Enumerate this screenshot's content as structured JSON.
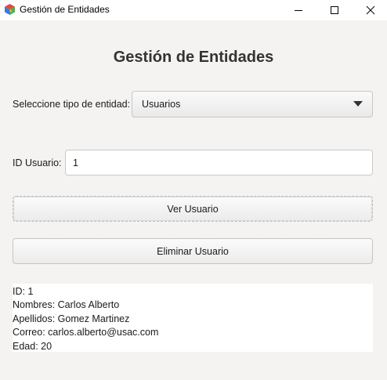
{
  "window": {
    "title": "Gestión de Entidades",
    "minimize_glyph": "—",
    "maximize_glyph": "☐",
    "close_glyph": "✕"
  },
  "main": {
    "heading": "Gestión de Entidades",
    "entity_type_label": "Seleccione tipo de entidad:",
    "entity_type_selected": "Usuarios",
    "id_label": "ID Usuario:",
    "id_value": "1",
    "view_button": "Ver Usuario",
    "delete_button": "Eliminar Usuario"
  },
  "output": {
    "lines": [
      "ID: 1",
      "Nombres: Carlos Alberto",
      "Apellidos: Gomez Martinez",
      "Correo: carlos.alberto@usac.com",
      "Edad: 20"
    ]
  },
  "icons": {
    "app": "app-logo-icon",
    "dropdown": "chevron-down-icon"
  }
}
